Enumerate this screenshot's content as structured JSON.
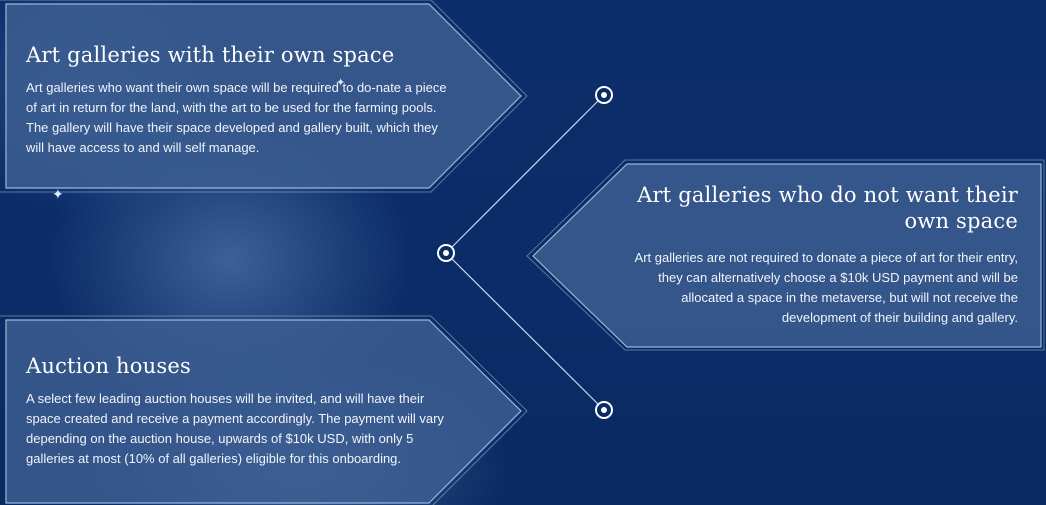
{
  "sections": [
    {
      "title": "Art galleries with their own space",
      "body": "Art galleries who want their own space will be required to do-nate a piece of art in return for the land, with the art to be used for the farming pools. The gallery will have their space developed and gallery built, which they will have access to and will self manage."
    },
    {
      "title": "Art galleries who do not want their own space",
      "body": "Art galleries are not required to donate a piece of art for their entry, they can alternatively choose a $10k USD payment and will be allocated a space in the metaverse, but will not receive the development of their building and gallery."
    },
    {
      "title": "Auction houses",
      "body": "A select few leading auction houses will be invited, and will have their space created and receive a payment accordingly. The payment will vary depending on the auction house, upwards of $10k USD, with only 5 galleries at most (10% of all galleries) eligible for this onboarding."
    }
  ],
  "colors": {
    "background": "#0b2b66",
    "panel": "#3d5f92",
    "panel_border": "#9fb4d6",
    "text": "#ffffff"
  }
}
